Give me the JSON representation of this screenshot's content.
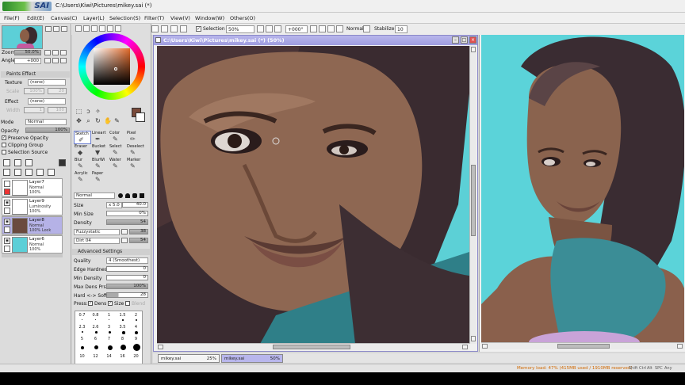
{
  "titlebar": {
    "path": "C:\\Users\\Kiwi\\Pictures\\mikey.sai (*)",
    "logo_text": "SAI"
  },
  "menu": {
    "items": [
      "File(F)",
      "Edit(E)",
      "Canvas(C)",
      "Layer(L)",
      "Selection(S)",
      "Filter(T)",
      "View(V)",
      "Window(W)",
      "Others(O)"
    ]
  },
  "toolbar": {
    "selection_label": "Selection",
    "zoom": "50%",
    "rotation": "+000°",
    "mode": "Normal",
    "stabilizer_label": "Stabilizer",
    "stabilizer_value": "10"
  },
  "navigator": {
    "zoom_label": "Zoom",
    "zoom_value": "50.0%",
    "angle_label": "Angle",
    "angle_value": "+000"
  },
  "paint_effect": {
    "title": "Paints Effect",
    "texture_label": "Texture",
    "texture_value": "(none)",
    "texture_scale": "Scale",
    "texture_scale_val": "100%",
    "texture_scale_num": "20",
    "effect_label": "Effect",
    "effect_value": "(none)",
    "effect_width": "Width",
    "effect_width_val": "1",
    "effect_width_num": "100"
  },
  "layer_props": {
    "mode_label": "Mode",
    "mode_value": "Normal",
    "opacity_label": "Opacity",
    "opacity_value": "100%",
    "preserve_opacity": "Preserve Opacity",
    "clipping_group": "Clipping Group",
    "selection_source": "Selection Source"
  },
  "layers": [
    {
      "name": "Layer7",
      "mode": "Normal",
      "opacity": "100%"
    },
    {
      "name": "Layer9",
      "mode": "Luminosity",
      "opacity": "100%"
    },
    {
      "name": "Layer8",
      "mode": "Normal",
      "opacity": "100% Lock"
    },
    {
      "name": "Layer6",
      "mode": "Normal",
      "opacity": "100%"
    }
  ],
  "brushes": [
    {
      "label": "Sketch"
    },
    {
      "label": "Lineart"
    },
    {
      "label": "Color"
    },
    {
      "label": "Pixel"
    },
    {
      "label": "Eraser"
    },
    {
      "label": "Bucket"
    },
    {
      "label": "Select"
    },
    {
      "label": "Deselect"
    },
    {
      "label": "Blur"
    },
    {
      "label": "BlurWi"
    },
    {
      "label": "Water"
    },
    {
      "label": "Marker"
    },
    {
      "label": "Acrylic"
    },
    {
      "label": "Paper"
    }
  ],
  "brush_settings": {
    "mode_value": "Normal",
    "size_label": "Size",
    "size_mult": "x 5.0",
    "size_value": "40.0",
    "minsize_label": "Min Size",
    "minsize_value": "0%",
    "density_label": "Density",
    "density_value": "54",
    "blend_tex": "Fuzzystatic",
    "blend_tex_num": "38",
    "dirt_tex": "Dirt 04",
    "dirt_tex_num": "54",
    "advanced_label": "Advanced Settings",
    "quality_label": "Quality",
    "quality_value": "4 (Smoothest)",
    "edge_label": "Edge Hardness",
    "edge_value": "0",
    "mindens_label": "Min Density",
    "mindens_value": "0",
    "maxdens_label": "Max Dens Prs.",
    "maxdens_value": "100%",
    "hardsoft_label": "Hard <-> Soft",
    "hardsoft_value": "28",
    "press_label": "Press:",
    "press_dens": "Dens",
    "press_size": "Size",
    "press_blend": "Blend"
  },
  "dot_sizes": [
    "0.7",
    "0.8",
    "1",
    "1.5",
    "2",
    "2.3",
    "2.6",
    "3",
    "3.5",
    "4",
    "5",
    "6",
    "7",
    "8",
    "9",
    "10",
    "12",
    "14",
    "16",
    "20"
  ],
  "canvas1": {
    "title": "C:\\Users\\Kiwi\\Pictures\\mikey.sai (*) (50%)"
  },
  "tabs": [
    {
      "name": "mikey.sai",
      "pct": "25%"
    },
    {
      "name": "mikey.sai",
      "pct": "50%"
    }
  ],
  "status": {
    "memory": "Memory load: 47% (415MB used / 1910MB reserved)",
    "keys": [
      "Shift",
      "Ctrl",
      "Alt",
      "SPC",
      "Any"
    ]
  },
  "colors": {
    "accent": "#b8b6ec",
    "fg_color": "#7a4a3a",
    "canvas_bg": "#5cd0d6"
  }
}
